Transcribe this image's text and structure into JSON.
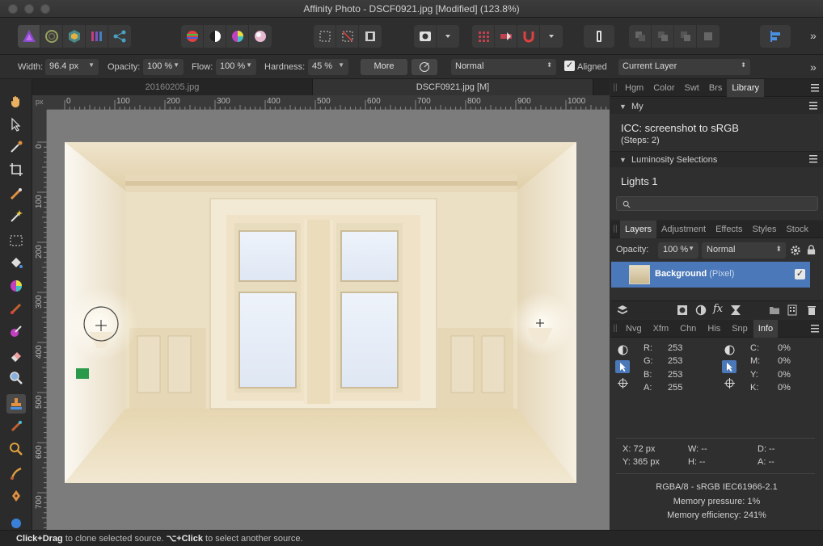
{
  "window": {
    "title": "Affinity Photo - DSCF0921.jpg [Modified] (123.8%)"
  },
  "context_toolbar": {
    "width_label": "Width:",
    "width_value": "96.4 px",
    "opacity_label": "Opacity:",
    "opacity_value": "100 %",
    "flow_label": "Flow:",
    "flow_value": "100 %",
    "hardness_label": "Hardness:",
    "hardness_value": "45 %",
    "more_label": "More",
    "blend_mode": "Normal",
    "aligned_label": "Aligned",
    "aligned_checked": true,
    "source_value": "Current Layer"
  },
  "doc_tabs": [
    "20160205.jpg",
    "DSCF0921.jpg [M]"
  ],
  "ruler": {
    "unit": "px",
    "h_ticks": [
      "0",
      "100",
      "200",
      "300",
      "400",
      "500",
      "600",
      "700",
      "800",
      "900",
      "1000"
    ],
    "v_ticks": [
      "0",
      "100",
      "200",
      "300",
      "400",
      "500",
      "600",
      "700"
    ]
  },
  "library_panel": {
    "tabs": [
      "Hgm",
      "Color",
      "Swt",
      "Brs",
      "Library"
    ],
    "active_tab": "Library",
    "section_my": "My",
    "macro_name": "ICC: screenshot to sRGB",
    "macro_steps": "(Steps: 2)",
    "section_luminosity": "Luminosity Selections",
    "lum_item": "Lights 1"
  },
  "layers_panel": {
    "tabs": [
      "Layers",
      "Adjustment",
      "Effects",
      "Styles",
      "Stock"
    ],
    "active_tab": "Layers",
    "opacity_label": "Opacity:",
    "opacity_value": "100 %",
    "blend_mode": "Normal",
    "layer_name": "Background",
    "layer_kind": "(Pixel)",
    "fx_label": "fx"
  },
  "info_panel": {
    "tabs": [
      "Nvg",
      "Xfm",
      "Chn",
      "His",
      "Snp",
      "Info"
    ],
    "active_tab": "Info",
    "rgba": [
      {
        "label": "R:",
        "value": "253"
      },
      {
        "label": "G:",
        "value": "253"
      },
      {
        "label": "B:",
        "value": "253"
      },
      {
        "label": "A:",
        "value": "255"
      }
    ],
    "cmyk": [
      {
        "label": "C:",
        "value": "0%"
      },
      {
        "label": "M:",
        "value": "0%"
      },
      {
        "label": "Y:",
        "value": "0%"
      },
      {
        "label": "K:",
        "value": "0%"
      }
    ],
    "x": "X: 72 px",
    "y": "Y: 365 px",
    "w": "W: --",
    "h": "H: --",
    "d": "D: --",
    "a": "A: --",
    "format": "RGBA/8 - sRGB IEC61966-2.1",
    "memory_pressure": "Memory pressure: 1%",
    "memory_efficiency": "Memory efficiency: 241%"
  },
  "status": {
    "part1_bold": "Click+Drag",
    "part1": " to clone selected source. ",
    "part2_bold": "⌥+Click",
    "part2": " to select another source."
  },
  "colors": {
    "accent": "#4b78b8",
    "canvas": "#7c7c7c",
    "panel": "#2f2f2f"
  }
}
